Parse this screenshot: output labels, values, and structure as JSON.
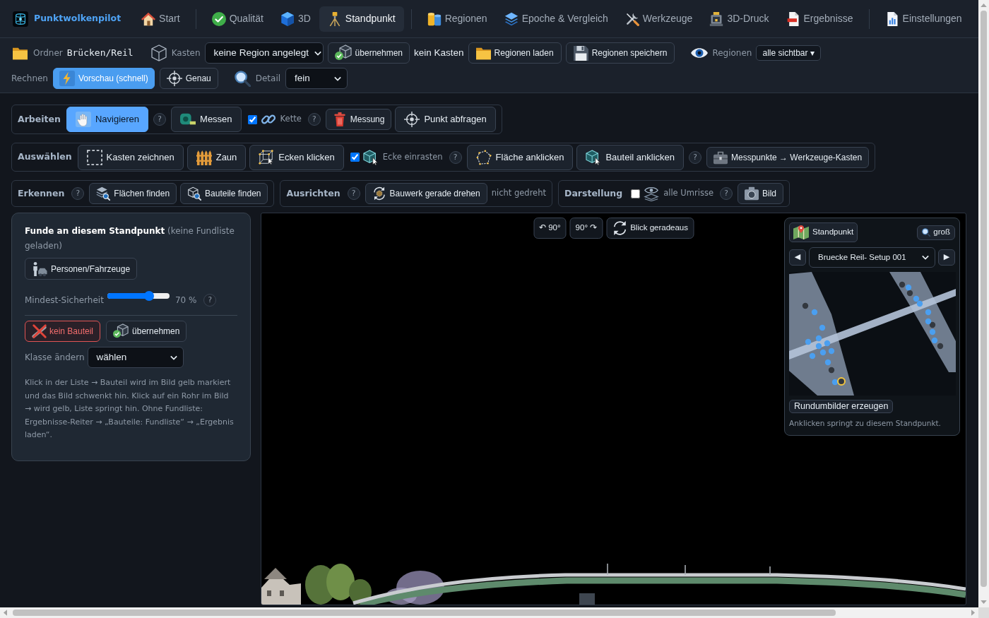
{
  "app": {
    "title": "Punktwolkenpilot"
  },
  "nav": [
    {
      "tabs": [
        {
          "label": "Start",
          "selected": false
        }
      ]
    },
    {
      "tabs": [
        {
          "label": "Qualität",
          "selected": false
        },
        {
          "label": "3D",
          "selected": false
        },
        {
          "label": "Standpunkt",
          "selected": true
        }
      ]
    },
    {
      "tabs": [
        {
          "label": "Regionen",
          "selected": false
        },
        {
          "label": "Epoche & Vergleich",
          "selected": false
        },
        {
          "label": "Werkzeuge",
          "selected": false
        },
        {
          "label": "3D-Druck",
          "selected": false
        },
        {
          "label": "Ergebnisse",
          "selected": false
        }
      ]
    },
    {
      "tabs": [
        {
          "label": "Einstellungen",
          "selected": false
        }
      ]
    }
  ],
  "toolbar": {
    "folder": {
      "label": "Ordner",
      "value": "Brücken/Reil"
    },
    "box": {
      "label": "Kasten",
      "select": "keine Region angelegt",
      "apply_button": "übernehmen",
      "status": "kein Kasten"
    },
    "region_buttons": [
      "Regionen laden",
      "Regionen speichern"
    ],
    "region_visibility": {
      "label": "Regionen",
      "dropdown": "alle sichtbar ▾"
    },
    "compute": {
      "label": "Rechnen",
      "modes": [
        {
          "label": "Vorschau (schnell)",
          "selected": true
        },
        {
          "label": "Genau",
          "selected": false
        }
      ]
    },
    "detail": {
      "label": "Detail",
      "select": "fein"
    }
  },
  "tool_rows": [
    {
      "groups": [
        {
          "title": "Arbeiten",
          "items": [
            {
              "kind": "tool",
              "label": "Navigieren",
              "selected": true
            },
            {
              "kind": "help",
              "label": "?"
            },
            {
              "kind": "tool",
              "label": "Messen",
              "selected": false
            },
            {
              "kind": "checkbox",
              "label": "Kette",
              "checked": true
            },
            {
              "kind": "help",
              "label": "?"
            },
            {
              "kind": "action",
              "label": "Messung"
            },
            {
              "kind": "tool",
              "label": "Punkt abfragen",
              "selected": false
            }
          ]
        }
      ]
    },
    {
      "groups": [
        {
          "title": "Auswählen",
          "items": [
            {
              "kind": "tool",
              "label": "Kasten zeichnen",
              "selected": false
            },
            {
              "kind": "tool",
              "label": "Zaun",
              "selected": false
            },
            {
              "kind": "tool",
              "label": "Ecken klicken",
              "selected": false
            },
            {
              "kind": "checkbox",
              "label": "Ecke einrasten",
              "checked": true
            },
            {
              "kind": "help",
              "label": "?"
            },
            {
              "kind": "tool",
              "label": "Fläche anklicken",
              "selected": false
            },
            {
              "kind": "tool",
              "label": "Bauteil anklicken",
              "selected": false
            },
            {
              "kind": "help",
              "label": "?"
            },
            {
              "kind": "action",
              "label": "Messpunkte → Werkzeuge-Kasten"
            }
          ]
        }
      ]
    },
    {
      "groups": [
        {
          "title": "Erkennen",
          "items": [
            {
              "kind": "help",
              "label": "?"
            },
            {
              "kind": "action",
              "label": "Flächen finden"
            },
            {
              "kind": "action",
              "label": "Bauteile finden"
            }
          ]
        },
        {
          "title": "Ausrichten",
          "items": [
            {
              "kind": "help",
              "label": "?"
            },
            {
              "kind": "action",
              "label": "Bauwerk gerade drehen"
            },
            {
              "kind": "status",
              "label": "nicht gedreht"
            }
          ]
        },
        {
          "title": "Darstellung",
          "items": [
            {
              "kind": "checkbox",
              "label": "alle Umrisse",
              "checked": false
            },
            {
              "kind": "help",
              "label": "?"
            },
            {
              "kind": "action",
              "label": "Bild"
            }
          ]
        }
      ]
    }
  ],
  "findings_panel": {
    "title": "**Funde an diesem Standpunkt** (keine Fundliste geladen)",
    "filter_button": "Personen/Fahrzeuge",
    "confidence": {
      "label": "Mindest-Sicherheit",
      "level": 0.7,
      "reading": "70 %",
      "help": "?"
    },
    "actions": [
      {
        "kind": "danger",
        "label": "kein Bauteil"
      },
      {
        "kind": "normal",
        "label": "übernehmen"
      }
    ],
    "class_select": {
      "label": "Klasse ändern",
      "value": "wählen"
    },
    "help_text": "Klick in der Liste → Bauteil wird im Bild gelb markiert und das Bild schwenkt hin. Klick auf ein Rohr im Bild → wird gelb, Liste springt hin. Ohne Fundliste: Ergebnisse-Reiter → „Bauteile: Fundliste“ → „Ergebnis laden“."
  },
  "viewport": {
    "view_buttons": [
      "↶ 90°",
      "90° ↷",
      "Blick geradeaus"
    ],
    "station_panel": {
      "title_button": "Standpunkt",
      "zoom_button": "groß",
      "prev": "◀",
      "station": "Bruecke Reil- Setup 001",
      "next": "▶",
      "panorama_button": "Rundumbilder erzeugen",
      "hint": "Anklicken springt zu diesem Standpunkt."
    }
  }
}
